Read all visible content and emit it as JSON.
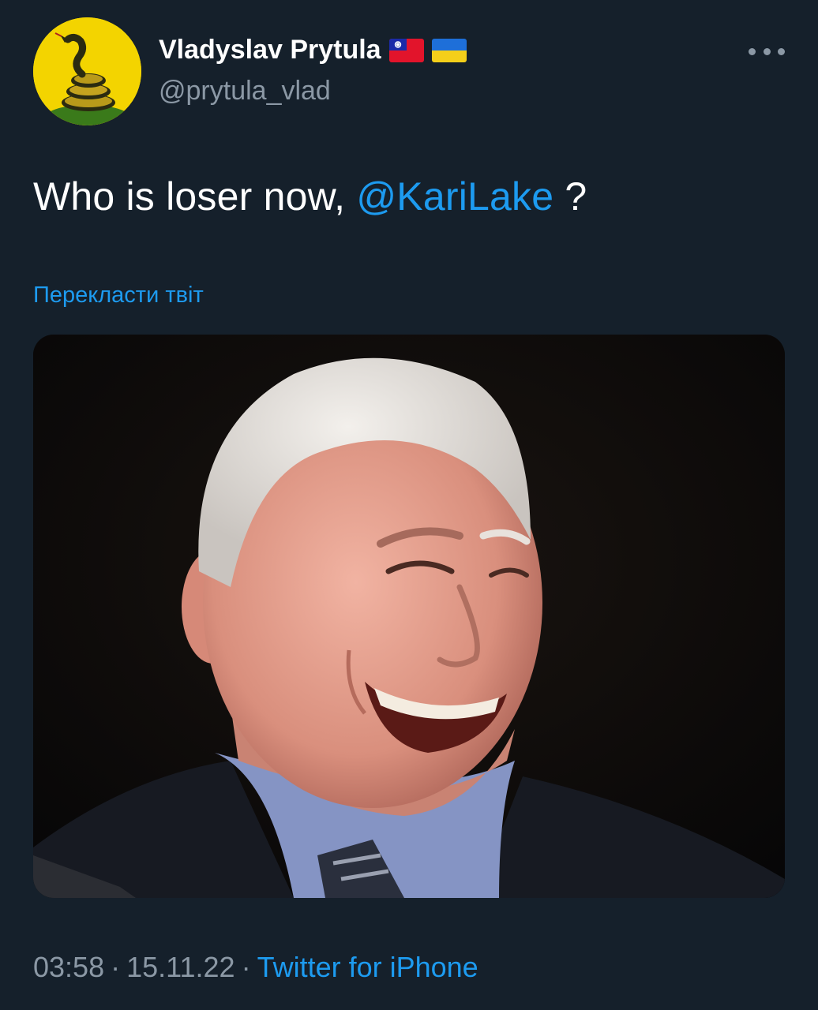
{
  "author": {
    "display_name": "Vladyslav Prytula",
    "handle": "@prytula_vlad",
    "flags": [
      "taiwan-flag",
      "ukraine-flag"
    ],
    "avatar_icon": "gadsden-snake-icon"
  },
  "tweet": {
    "text_before": "Who is loser now, ",
    "mention": "@KariLake",
    "text_after": " ?",
    "translate_label": "Перекласти твіт",
    "media_description_icon": "photo-laughing-man"
  },
  "footer": {
    "time": "03:58",
    "separator": "·",
    "date": "15.11.22",
    "source": "Twitter for iPhone"
  },
  "colors": {
    "background": "#15202b",
    "accent": "#1d9bf0",
    "secondary_text": "#8b98a5",
    "primary_text": "#ffffff"
  }
}
